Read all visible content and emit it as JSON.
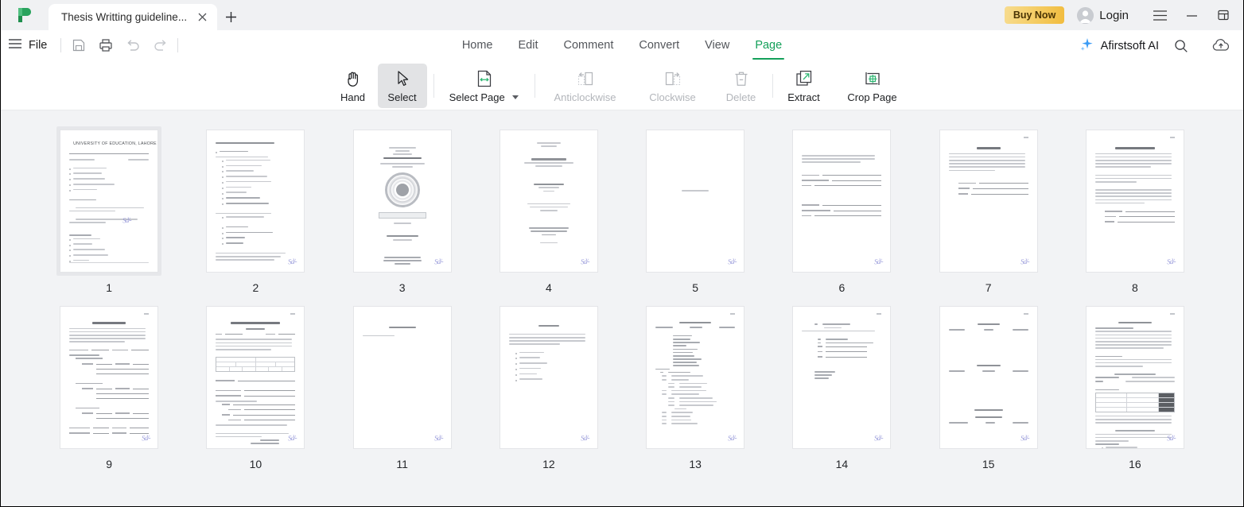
{
  "window": {
    "titlebar": {
      "logo_icon": "afirstsoft-logo-icon",
      "tab": {
        "title": "Thesis Writting guideline...",
        "close_icon": "close-icon"
      },
      "new_tab_icon": "plus-icon",
      "buy_now_label": "Buy Now",
      "login_label": "Login",
      "avatar_icon": "user-avatar-icon",
      "menu_icon": "hamburger-menu-icon",
      "minimize_icon": "minimize-icon",
      "restore_icon": "restore-window-icon"
    },
    "menubar": {
      "file_label": "File",
      "file_menu_icon": "hamburger-menu-icon",
      "quick_actions": [
        {
          "name": "save-icon",
          "disabled": false
        },
        {
          "name": "print-icon",
          "disabled": false
        },
        {
          "name": "undo-icon",
          "disabled": true
        },
        {
          "name": "redo-icon",
          "disabled": true
        }
      ],
      "tabs": [
        {
          "label": "Home",
          "active": false
        },
        {
          "label": "Edit",
          "active": false
        },
        {
          "label": "Comment",
          "active": false
        },
        {
          "label": "Convert",
          "active": false
        },
        {
          "label": "View",
          "active": false
        },
        {
          "label": "Page",
          "active": true
        }
      ],
      "ai_label": "Afirstsoft AI",
      "ai_icon": "sparkle-ai-icon",
      "search_icon": "search-icon",
      "cloud_icon": "cloud-upload-icon",
      "active_accent": "#14a05a"
    },
    "toolbar": {
      "items": [
        {
          "label": "Hand",
          "icon": "hand-icon",
          "active": false,
          "disabled": false,
          "dropdown": false
        },
        {
          "label": "Select",
          "icon": "cursor-arrow-icon",
          "active": true,
          "disabled": false,
          "dropdown": false
        },
        {
          "label": "Select Page",
          "icon": "select-page-icon",
          "active": false,
          "disabled": false,
          "dropdown": true
        },
        {
          "label": "Anticlockwise",
          "icon": "rotate-left-icon",
          "active": false,
          "disabled": true,
          "dropdown": false
        },
        {
          "label": "Clockwise",
          "icon": "rotate-right-icon",
          "active": false,
          "disabled": true,
          "dropdown": false
        },
        {
          "label": "Delete",
          "icon": "trash-icon",
          "active": false,
          "disabled": true,
          "dropdown": false
        },
        {
          "label": "Extract",
          "icon": "extract-icon",
          "active": false,
          "disabled": false,
          "dropdown": false
        },
        {
          "label": "Crop Page",
          "icon": "crop-page-icon",
          "active": false,
          "disabled": false,
          "dropdown": false
        }
      ]
    }
  },
  "pages_panel": {
    "background": "#f2f3f5",
    "signature_color": "#8d8fd6",
    "selected_page": 1,
    "columns": 8,
    "pages": [
      {
        "number": "1",
        "kind": "letterhead",
        "heading": "UNIVERSITY OF EDUCATION, LAHORE",
        "selected": true
      },
      {
        "number": "2",
        "kind": "bullet-list",
        "heading": "The thesis should include the following chapters:",
        "selected": false
      },
      {
        "number": "3",
        "kind": "title-page",
        "heading": "TYPE THESIS TITLE HERE",
        "selected": false
      },
      {
        "number": "4",
        "kind": "title-page-2",
        "heading": "Type Your Thesis Title Here",
        "selected": false
      },
      {
        "number": "5",
        "kind": "near-blank",
        "heading": "",
        "selected": false
      },
      {
        "number": "6",
        "kind": "signature",
        "heading": "",
        "selected": false
      },
      {
        "number": "7",
        "kind": "declaration",
        "heading": "DECLARATION",
        "selected": false
      },
      {
        "number": "8",
        "kind": "plagiarism",
        "heading": "PLAGIARISM UNDERTAKING",
        "selected": false
      },
      {
        "number": "9",
        "kind": "certification",
        "heading": "CERTIFICATION APPROVAL",
        "selected": false
      },
      {
        "number": "10",
        "kind": "notification",
        "heading": "OFFICE OF THE CONTROLLER EXAMINATION",
        "selected": false
      },
      {
        "number": "11",
        "kind": "chapter",
        "heading": "ACKNOWLEDGEMENT",
        "selected": false
      },
      {
        "number": "12",
        "kind": "abstract",
        "heading": "ABSTRACT",
        "selected": false
      },
      {
        "number": "13",
        "kind": "toc",
        "heading": "TABLE OF CONTENTS",
        "selected": false
      },
      {
        "number": "14",
        "kind": "litreview",
        "heading": "LITERATURE REVIEW",
        "selected": false
      },
      {
        "number": "15",
        "kind": "lists",
        "heading": "LIST OF TABLES",
        "selected": false
      },
      {
        "number": "16",
        "kind": "submission",
        "heading": "SUBMISSION OF THESIS",
        "selected": false
      }
    ]
  }
}
